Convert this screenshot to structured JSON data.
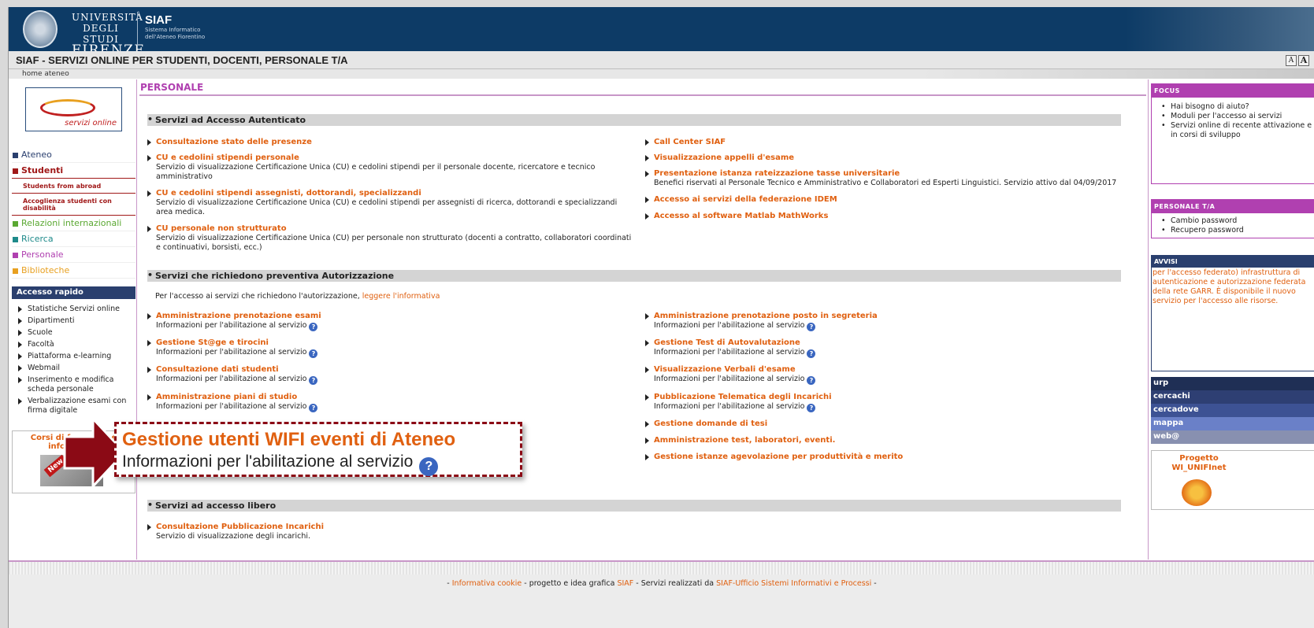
{
  "header": {
    "university": [
      "UNIVERSITÀ",
      "DEGLI STUDI",
      "FIRENZE"
    ],
    "siaf": "SIAF",
    "siaf_sub": [
      "Sistema Informatico",
      "dell'Ateneo Fiorentino"
    ],
    "title": "SIAF - SERVIZI ONLINE PER STUDENTI, DOCENTI, PERSONALE T/A",
    "font_small": "A",
    "font_large": "A",
    "breadcrumb": "home ateneo"
  },
  "left": {
    "logo_label": "servizi online",
    "nav": [
      {
        "label": "Ateneo",
        "color": "#2a3f6e"
      },
      {
        "label": "Studenti",
        "color": "#a01818"
      }
    ],
    "studenti_sub": [
      "Students from abroad",
      "Accoglienza studenti con disabilità"
    ],
    "nav2": [
      {
        "label": "Relazioni internazionali",
        "color": "#5aa832"
      },
      {
        "label": "Ricerca",
        "color": "#1e8a8a"
      },
      {
        "label": "Personale",
        "color": "#b040b0"
      },
      {
        "label": "Biblioteche",
        "color": "#e8a020"
      }
    ],
    "accesso_rapido": "Accesso rapido",
    "quick_links": [
      "Statistiche Servizi online",
      "Dipartimenti",
      "Scuole",
      "Facoltà",
      "Piattaforma e-learning",
      "Webmail",
      "Inserimento e modifica scheda personale",
      "Verbalizzazione esami con firma digitale"
    ],
    "corsi": "Corsi di formazione informatica",
    "new_badge": "New"
  },
  "main": {
    "heading": "PERSONALE",
    "sec1": "Servizi ad Accesso Autenticato",
    "sec2": "Servizi che richiedono preventiva Autorizzazione",
    "sec3": "Servizi ad accesso libero",
    "note": "Per l'accesso ai servizi che richiedono l'autorizzazione,",
    "note_link": "leggere l'informativa",
    "auth_left": [
      {
        "name": "Consultazione stato delle presenze",
        "desc": ""
      },
      {
        "name": "CU e cedolini stipendi personale",
        "desc": "Servizio di visualizzazione Certificazione Unica (CU) e cedolini stipendi per il personale docente, ricercatore e tecnico amministrativo"
      },
      {
        "name": "CU e cedolini stipendi assegnisti, dottorandi, specializzandi",
        "desc": "Servizio di visualizzazione Certificazione Unica (CU) e cedolini stipendi per assegnisti di ricerca, dottorandi e specializzandi area medica."
      },
      {
        "name": "CU personale non strutturato",
        "desc": "Servizio di visualizzazione Certificazione Unica (CU) per personale non strutturato (docenti a contratto, collaboratori coordinati e continuativi, borsisti, ecc.)"
      }
    ],
    "auth_right": [
      {
        "name": "Call Center SIAF",
        "desc": ""
      },
      {
        "name": "Visualizzazione appelli d'esame",
        "desc": ""
      },
      {
        "name": "Presentazione istanza rateizzazione tasse universitarie",
        "desc": "Benefici riservati al Personale Tecnico e Amministrativo e Collaboratori ed Esperti Linguistici. Servizio attivo dal 04/09/2017"
      },
      {
        "name": "Accesso ai servizi della federazione IDEM",
        "desc": ""
      },
      {
        "name": "Accesso al software Matlab MathWorks",
        "desc": ""
      }
    ],
    "info_text": "Informazioni per l'abilitazione al servizio",
    "pre_left": [
      "Amministrazione prenotazione esami",
      "Gestione St@ge e tirocini",
      "Consultazione dati studenti",
      "Amministrazione piani di studio"
    ],
    "pre_right": [
      "Amministrazione prenotazione posto in segreteria",
      "Gestione Test di Autovalutazione",
      "Visualizzazione Verbali d'esame",
      "Pubblicazione Telematica degli Incarichi"
    ],
    "pre_right_noinfo": [
      "Gestione domande di tesi",
      "Amministrazione test, laboratori, eventi.",
      "Gestione istanze agevolazione per produttività e merito"
    ],
    "free": {
      "name": "Consultazione Pubblicazione Incarichi",
      "desc": "Servizio di visualizzazione degli incarichi."
    }
  },
  "right": {
    "focus": "FOCUS",
    "focus_items": [
      "Hai bisogno di aiuto?",
      "Moduli per l'accesso ai servizi",
      "Servizi online di recente attivazione e in corsi di sviluppo"
    ],
    "personale_ta": "PERSONALE T/A",
    "personale_items": [
      "Cambio password",
      "Recupero password"
    ],
    "avvisi": "AVVISI",
    "avvisi_text": "per l'accesso federato) infrastruttura di autenticazione e autorizzazione federata della rete GARR. È disponibile il nuovo servizio per l'accesso alle risorse.",
    "links": [
      {
        "label": "urp",
        "color": "#1f2f55"
      },
      {
        "label": "cercachi",
        "color": "#2e3f73"
      },
      {
        "label": "cercadove",
        "color": "#3d5294"
      },
      {
        "label": "mappa",
        "color": "#6a80c8"
      },
      {
        "label": "web@",
        "color": "#8890b0"
      }
    ],
    "project": "Progetto WI_UNIFInet"
  },
  "footer": {
    "sep": "-",
    "cookie": "Informativa cookie",
    "mid": "- progetto e idea grafica",
    "siaf": "SIAF",
    "mid2": "- Servizi realizzati da",
    "office": "SIAF-Ufficio Sistemi Informativi e Processi",
    "end": "-"
  },
  "callout": {
    "name": "Gestione utenti WIFI eventi di Ateneo",
    "desc": "Informazioni per l'abilitazione al servizio"
  },
  "colors": {
    "accent": "#e06010",
    "banner": "#0d3b66",
    "purple": "#b040b0",
    "callout_border": "#8b0a15"
  }
}
